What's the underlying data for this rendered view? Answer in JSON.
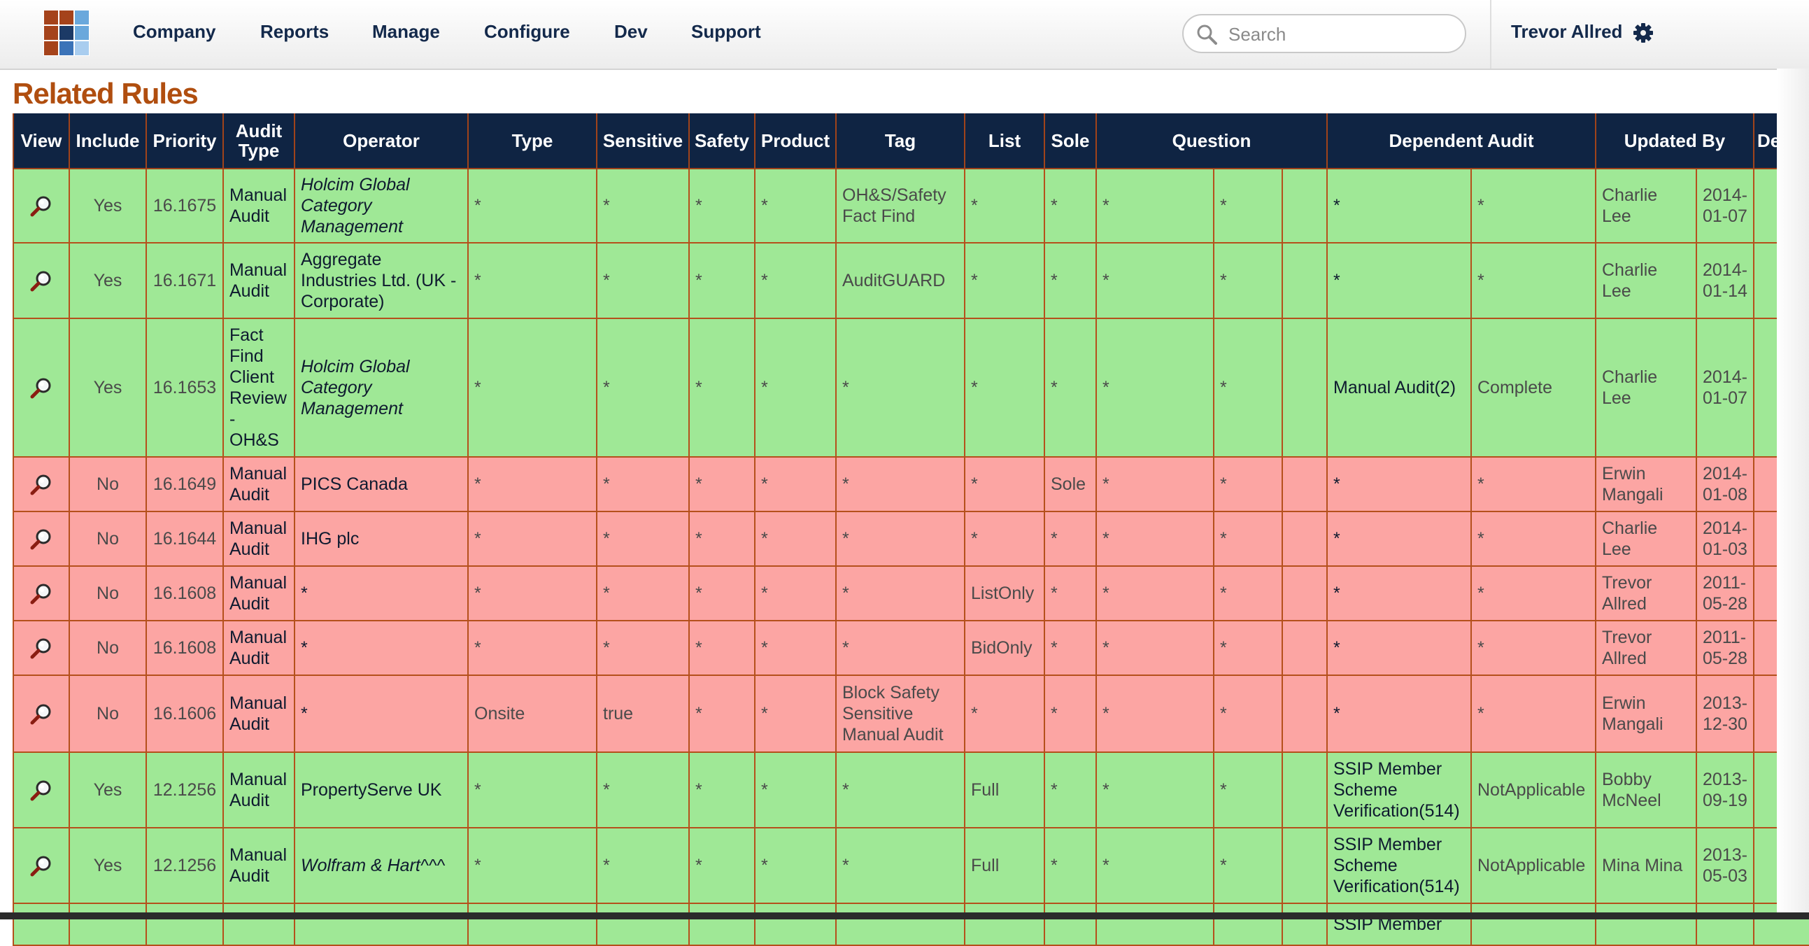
{
  "nav": {
    "items": [
      "Company",
      "Reports",
      "Manage",
      "Configure",
      "Dev",
      "Support"
    ],
    "search_placeholder": "Search",
    "user_name": "Trevor Allred"
  },
  "page_title": "Related Rules",
  "table": {
    "headers": {
      "view": "View",
      "include": "Include",
      "priority": "Priority",
      "audit_type": "Audit Type",
      "operator": "Operator",
      "type": "Type",
      "sensitive": "Sensitive",
      "safety": "Safety",
      "product": "Product",
      "tag": "Tag",
      "list": "List",
      "sole": "Sole",
      "question": "Question",
      "dependent_audit": "Dependent Audit",
      "updated_by": "Updated By",
      "delete": "Delete"
    },
    "rows": [
      {
        "status": "green",
        "include": "Yes",
        "priority": "16.1675",
        "audit_type": "Manual Audit",
        "operator": "Holcim Global Category Management",
        "operator_italic": true,
        "type": "*",
        "sensitive": "*",
        "safety": "*",
        "product": "*",
        "tag": "OH&S/Safety Fact Find",
        "list": "*",
        "sole": "*",
        "question": "*",
        "question_answer": "*",
        "dependent_audit": "*",
        "dependent_status": "*",
        "updated_by": "Charlie Lee",
        "updated_date": "2014-01-07"
      },
      {
        "status": "green",
        "include": "Yes",
        "priority": "16.1671",
        "audit_type": "Manual Audit",
        "operator": "Aggregate Industries Ltd. (UK - Corporate)",
        "operator_italic": false,
        "type": "*",
        "sensitive": "*",
        "safety": "*",
        "product": "*",
        "tag": "AuditGUARD",
        "list": "*",
        "sole": "*",
        "question": "*",
        "question_answer": "*",
        "dependent_audit": "*",
        "dependent_status": "*",
        "updated_by": "Charlie Lee",
        "updated_date": "2014-01-14"
      },
      {
        "status": "green",
        "include": "Yes",
        "priority": "16.1653",
        "audit_type": "Fact Find Client Review - OH&S",
        "operator": "Holcim Global Category Management",
        "operator_italic": true,
        "type": "*",
        "sensitive": "*",
        "safety": "*",
        "product": "*",
        "tag": "*",
        "list": "*",
        "sole": "*",
        "question": "*",
        "question_answer": "*",
        "dependent_audit": "Manual Audit(2)",
        "dependent_status": "Complete",
        "updated_by": "Charlie Lee",
        "updated_date": "2014-01-07"
      },
      {
        "status": "red",
        "include": "No",
        "priority": "16.1649",
        "audit_type": "Manual Audit",
        "operator": "PICS Canada",
        "operator_italic": false,
        "type": "*",
        "sensitive": "*",
        "safety": "*",
        "product": "*",
        "tag": "*",
        "list": "*",
        "sole": "Sole",
        "question": "*",
        "question_answer": "*",
        "dependent_audit": "*",
        "dependent_status": "*",
        "updated_by": "Erwin Mangali",
        "updated_date": "2014-01-08"
      },
      {
        "status": "red",
        "include": "No",
        "priority": "16.1644",
        "audit_type": "Manual Audit",
        "operator": "IHG plc",
        "operator_italic": false,
        "type": "*",
        "sensitive": "*",
        "safety": "*",
        "product": "*",
        "tag": "*",
        "list": "*",
        "sole": "*",
        "question": "*",
        "question_answer": "*",
        "dependent_audit": "*",
        "dependent_status": "*",
        "updated_by": "Charlie Lee",
        "updated_date": "2014-01-03"
      },
      {
        "status": "red",
        "include": "No",
        "priority": "16.1608",
        "audit_type": "Manual Audit",
        "operator": "*",
        "operator_italic": false,
        "type": "*",
        "sensitive": "*",
        "safety": "*",
        "product": "*",
        "tag": "*",
        "list": "ListOnly",
        "sole": "*",
        "question": "*",
        "question_answer": "*",
        "dependent_audit": "*",
        "dependent_status": "*",
        "updated_by": "Trevor Allred",
        "updated_date": "2011-05-28"
      },
      {
        "status": "red",
        "include": "No",
        "priority": "16.1608",
        "audit_type": "Manual Audit",
        "operator": "*",
        "operator_italic": false,
        "type": "*",
        "sensitive": "*",
        "safety": "*",
        "product": "*",
        "tag": "*",
        "list": "BidOnly",
        "sole": "*",
        "question": "*",
        "question_answer": "*",
        "dependent_audit": "*",
        "dependent_status": "*",
        "updated_by": "Trevor Allred",
        "updated_date": "2011-05-28"
      },
      {
        "status": "red",
        "include": "No",
        "priority": "16.1606",
        "audit_type": "Manual Audit",
        "operator": "*",
        "operator_italic": false,
        "type": "Onsite",
        "sensitive": "true",
        "safety": "*",
        "product": "*",
        "tag": "Block Safety Sensitive Manual Audit",
        "list": "*",
        "sole": "*",
        "question": "*",
        "question_answer": "*",
        "dependent_audit": "*",
        "dependent_status": "*",
        "updated_by": "Erwin Mangali",
        "updated_date": "2013-12-30"
      },
      {
        "status": "green",
        "include": "Yes",
        "priority": "12.1256",
        "audit_type": "Manual Audit",
        "operator": "PropertyServe UK",
        "operator_italic": false,
        "type": "*",
        "sensitive": "*",
        "safety": "*",
        "product": "*",
        "tag": "*",
        "list": "Full",
        "sole": "*",
        "question": "*",
        "question_answer": "*",
        "dependent_audit": "SSIP Member Scheme Verification(514)",
        "dependent_status": "NotApplicable",
        "updated_by": "Bobby McNeel",
        "updated_date": "2013-09-19"
      },
      {
        "status": "green",
        "include": "Yes",
        "priority": "12.1256",
        "audit_type": "Manual Audit",
        "operator": "Wolfram & Hart^^^",
        "operator_italic": true,
        "type": "*",
        "sensitive": "*",
        "safety": "*",
        "product": "*",
        "tag": "*",
        "list": "Full",
        "sole": "*",
        "question": "*",
        "question_answer": "*",
        "dependent_audit": "SSIP Member Scheme Verification(514)",
        "dependent_status": "NotApplicable",
        "updated_by": "Mina Mina",
        "updated_date": "2013-05-03"
      },
      {
        "status": "green",
        "include": "",
        "priority": "",
        "audit_type": "",
        "operator": "",
        "operator_italic": false,
        "type": "",
        "sensitive": "",
        "safety": "",
        "product": "",
        "tag": "",
        "list": "",
        "sole": "",
        "question": "",
        "question_answer": "",
        "dependent_audit": "SSIP Member",
        "dependent_status": "",
        "updated_by": "",
        "updated_date": ""
      }
    ]
  },
  "colors": {
    "header_bg": "#0f2443",
    "row_included": "#9fe896",
    "row_excluded": "#fca5a3",
    "title": "#b04e0f",
    "delete_icon": "#e8403c",
    "cell_border": "#b5501c"
  },
  "icons": {
    "logo": "logo-grid-icon",
    "search": "search-icon",
    "settings": "gear-icon",
    "view": "magnifier-icon",
    "delete": "delete-x-icon"
  }
}
